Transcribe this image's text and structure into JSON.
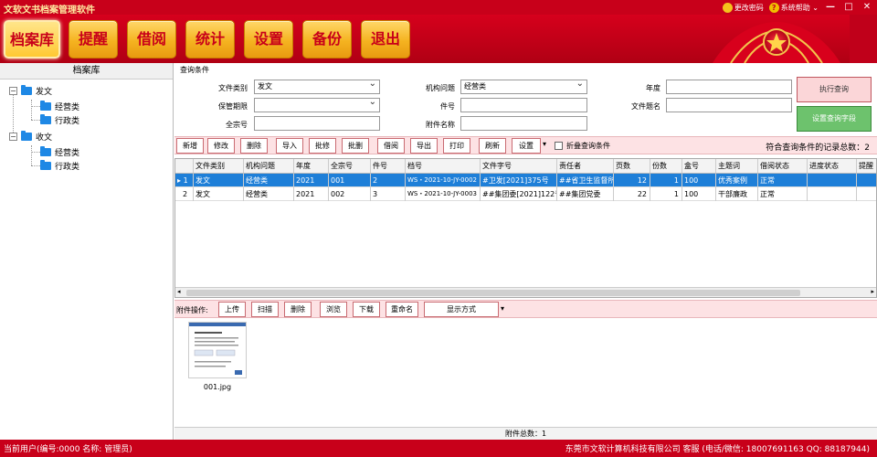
{
  "window": {
    "title": "文软文书档案管理软件",
    "change_password": "更改密码",
    "help": "系统帮助"
  },
  "menu": [
    "档案库",
    "提醒",
    "借阅",
    "统计",
    "设置",
    "备份",
    "退出"
  ],
  "tree": {
    "header": "档案库",
    "nodes": [
      {
        "label": "发文",
        "children": [
          "经营类",
          "行政类"
        ]
      },
      {
        "label": "收文",
        "children": [
          "经营类",
          "行政类"
        ]
      }
    ]
  },
  "query": {
    "legend": "查询条件",
    "labels": {
      "doc_type": "文件类别",
      "keep_period": "保管期限",
      "fonds_no": "全宗号",
      "org_issue": "机构问题",
      "item_no": "件号",
      "att_name": "附件名称",
      "year": "年度",
      "title": "文件题名"
    },
    "values": {
      "doc_type": "发文",
      "keep_period": "",
      "fonds_no": "",
      "org_issue": "经营类",
      "item_no": "",
      "att_name": "",
      "year": "",
      "title": ""
    },
    "execute_button": "执行查询",
    "fields_button": "设置查询字段"
  },
  "toolbar": {
    "buttons": [
      "新增",
      "修改",
      "删除",
      "导入",
      "批修",
      "批删",
      "借阅",
      "导出",
      "打印",
      "刷新",
      "设置"
    ],
    "fold_label": "折叠查询条件",
    "count_label": "符合查询条件的记录总数：2"
  },
  "grid": {
    "columns": [
      "文件类别",
      "机构问题",
      "年度",
      "全宗号",
      "件号",
      "档号",
      "文件字号",
      "责任者",
      "页数",
      "份数",
      "盒号",
      "主题词",
      "借阅状态",
      "进度状态",
      "提醒"
    ],
    "rows": [
      {
        "index": "1",
        "marker": "▸",
        "cells": [
          "发文",
          "经营类",
          "2021",
          "001",
          "2",
          "WS・2021-10-JY-0002",
          "#卫发[2021]375号",
          "##省卫生监督所",
          "12",
          "1",
          "100",
          "优秀案例",
          "正常",
          "",
          ""
        ]
      },
      {
        "index": "2",
        "marker": "",
        "cells": [
          "发文",
          "经营类",
          "2021",
          "002",
          "3",
          "WS・2021-10-JY-0003",
          "##集团委[2021]122号",
          "##集团党委",
          "22",
          "1",
          "100",
          "干部廉政",
          "正常",
          "",
          ""
        ]
      }
    ]
  },
  "attachments": {
    "label": "附件操作:",
    "buttons": [
      "上传",
      "扫描",
      "删除",
      "浏览",
      "下载",
      "重命名",
      "显示方式"
    ],
    "files": [
      {
        "name": "001.jpg"
      }
    ],
    "total_label": "附件总数：1"
  },
  "status": {
    "left": "当前用户(编号:0000 名称: 管理员)",
    "right": "东莞市文软计算机科技有限公司  客服 (电话/微信: 18007691163  QQ: 88187944)"
  },
  "colors": {
    "brand_red": "#c8001a",
    "menu_gold": "#f5b320",
    "selected_row": "#1e7fd8",
    "toolbar_pink": "#fde2e4"
  }
}
